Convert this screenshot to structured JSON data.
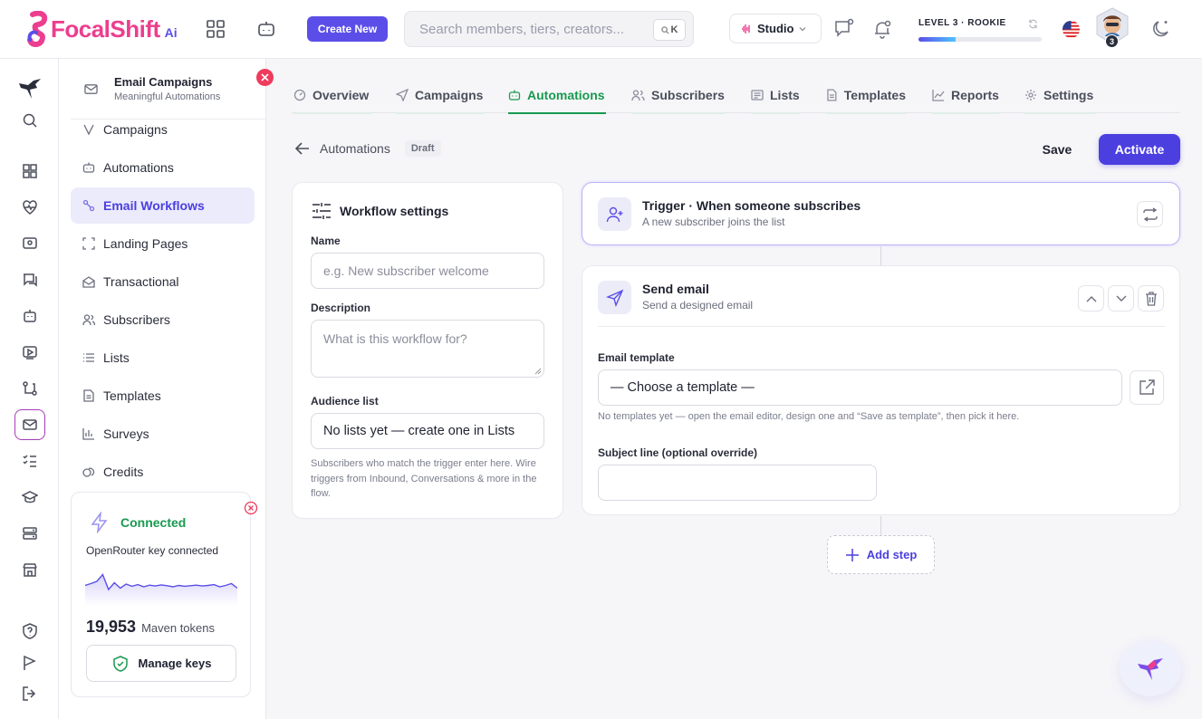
{
  "brand": {
    "name": "FocalShift",
    "suffix": "Ai",
    "pink": "#ec3e8e",
    "purple": "#5b4ee8"
  },
  "topbar": {
    "create_label": "Create New",
    "search_placeholder": "Search members, tiers, creators...",
    "search_shortcut": "K",
    "studio_label": "Studio",
    "level_label": "LEVEL 3 · ROOKIE",
    "level_progress": 0.3,
    "avatar_badge": "3"
  },
  "sidebar": {
    "header_title": "Email Campaigns",
    "header_subtitle": "Meaningful Automations",
    "items": [
      {
        "label": "Campaigns",
        "icon": "campaigns-icon"
      },
      {
        "label": "Automations",
        "icon": "robot-icon"
      },
      {
        "label": "Email Workflows",
        "icon": "workflow-icon",
        "active": true
      },
      {
        "label": "Landing Pages",
        "icon": "frame-icon"
      },
      {
        "label": "Transactional",
        "icon": "envelope-open-icon"
      },
      {
        "label": "Subscribers",
        "icon": "users-icon"
      },
      {
        "label": "Lists",
        "icon": "list-icon"
      },
      {
        "label": "Templates",
        "icon": "document-icon"
      },
      {
        "label": "Surveys",
        "icon": "bar-chart-icon"
      },
      {
        "label": "Credits",
        "icon": "coins-icon"
      }
    ],
    "connection": {
      "status": "Connected",
      "status_color": "#189a4f",
      "description": "OpenRouter key connected",
      "token_count": "19,953",
      "token_label": "Maven tokens",
      "manage_label": "Manage keys"
    }
  },
  "tabs": [
    {
      "label": "Overview",
      "icon": "gauge-icon"
    },
    {
      "label": "Campaigns",
      "icon": "send-icon"
    },
    {
      "label": "Automations",
      "icon": "robot-icon",
      "active": true
    },
    {
      "label": "Subscribers",
      "icon": "users-icon"
    },
    {
      "label": "Lists",
      "icon": "list-icon"
    },
    {
      "label": "Templates",
      "icon": "document-icon"
    },
    {
      "label": "Reports",
      "icon": "line-chart-icon"
    },
    {
      "label": "Settings",
      "icon": "gear-icon"
    }
  ],
  "breadcrumb": {
    "back_label": "Automations",
    "status": "Draft"
  },
  "actions": {
    "save": "Save",
    "activate": "Activate"
  },
  "settings": {
    "title": "Workflow settings",
    "name_label": "Name",
    "name_placeholder": "e.g. New subscriber welcome",
    "description_label": "Description",
    "description_placeholder": "What is this workflow for?",
    "audience_label": "Audience list",
    "audience_value": "No lists yet — create one in Lists",
    "audience_help": "Subscribers who match the trigger enter here. Wire triggers from Inbound, Conversations & more in the flow."
  },
  "trigger": {
    "title": "Trigger · When someone subscribes",
    "subtitle": "A new subscriber joins the list"
  },
  "send_step": {
    "title": "Send email",
    "subtitle": "Send a designed email",
    "template_label": "Email template",
    "template_value": "— Choose a template —",
    "template_help": "No templates yet — open the email editor, design one and “Save as template”, then pick it here.",
    "subject_label": "Subject line (optional override)",
    "subject_value": ""
  },
  "add_step_label": "Add step",
  "sparkline": [
    0.45,
    0.38,
    0.3,
    0.05,
    0.6,
    0.35,
    0.55,
    0.4,
    0.48,
    0.42,
    0.5,
    0.44,
    0.47,
    0.43,
    0.46,
    0.5,
    0.45,
    0.48,
    0.46,
    0.44,
    0.47,
    0.45,
    0.42,
    0.5,
    0.45,
    0.38,
    0.55
  ]
}
